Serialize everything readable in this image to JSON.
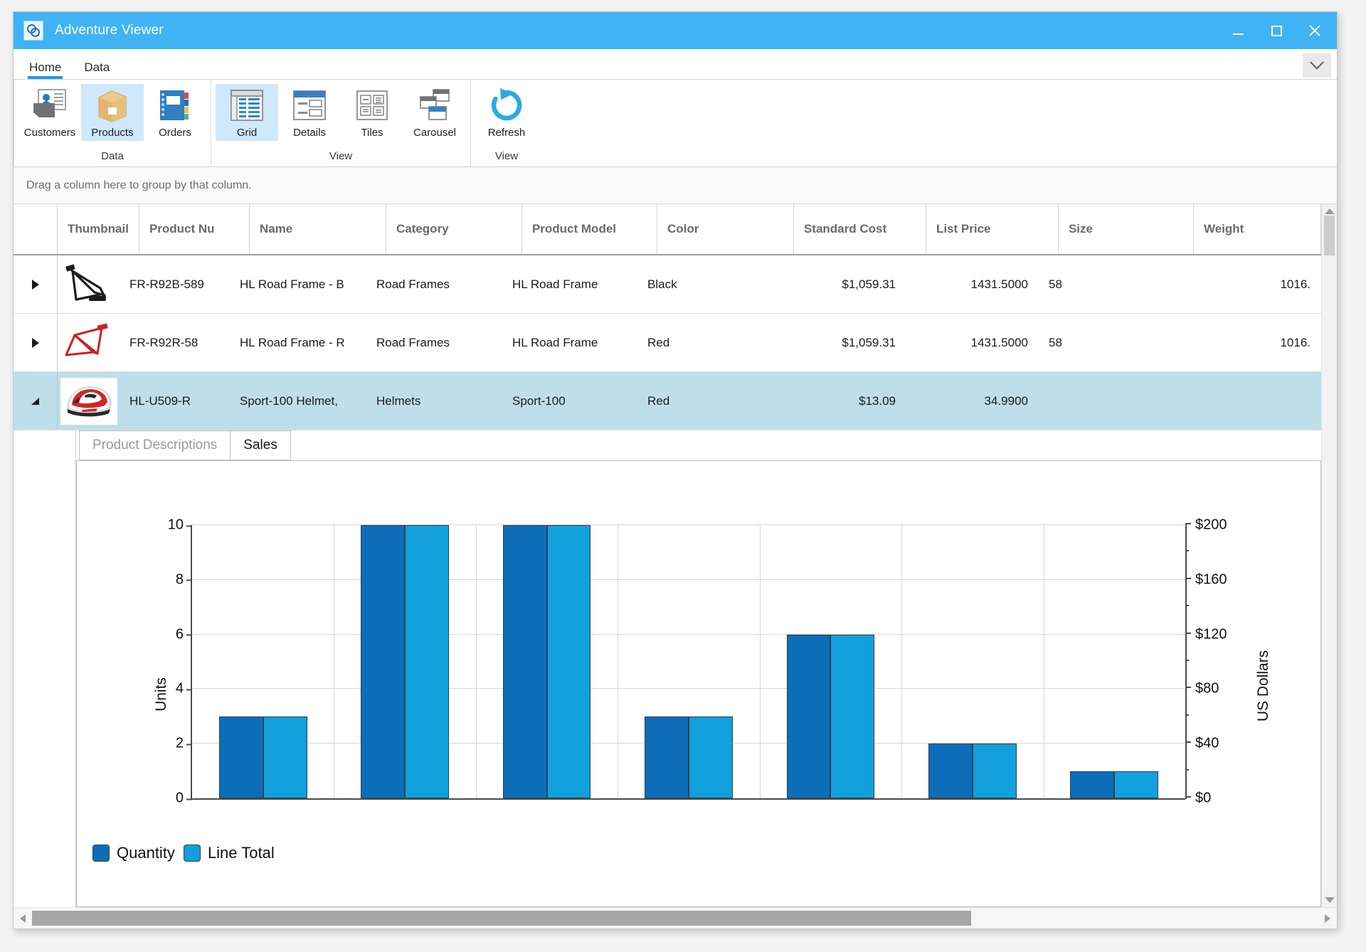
{
  "window": {
    "title": "Adventure Viewer",
    "icon": "app-icon",
    "minimize_label": "Minimize",
    "maximize_label": "Maximize",
    "close_label": "Close"
  },
  "ribbon": {
    "tabs": [
      {
        "label": "Home",
        "active": true
      },
      {
        "label": "Data",
        "active": false
      }
    ],
    "collapse_label": "Collapse the Ribbon",
    "groups": [
      {
        "label": "Data",
        "items": [
          {
            "label": "Customers",
            "icon": "customers-icon",
            "selected": false
          },
          {
            "label": "Products",
            "icon": "products-icon",
            "selected": true
          },
          {
            "label": "Orders",
            "icon": "orders-icon",
            "selected": false
          }
        ]
      },
      {
        "label": "View",
        "items": [
          {
            "label": "Grid",
            "icon": "grid-icon",
            "selected": true
          },
          {
            "label": "Details",
            "icon": "details-icon",
            "selected": false
          },
          {
            "label": "Tiles",
            "icon": "tiles-icon",
            "selected": false
          },
          {
            "label": "Carousel",
            "icon": "carousel-icon",
            "selected": false
          }
        ]
      },
      {
        "label": "View",
        "items": [
          {
            "label": "Refresh",
            "icon": "refresh-icon",
            "selected": false
          }
        ]
      }
    ]
  },
  "group_panel": {
    "hint": "Drag a column here to group by that column."
  },
  "grid": {
    "columns": [
      {
        "key": "thumbnail",
        "label": "Thumbnail"
      },
      {
        "key": "product_number",
        "label": "Product Nu"
      },
      {
        "key": "name",
        "label": "Name"
      },
      {
        "key": "category",
        "label": "Category"
      },
      {
        "key": "product_model",
        "label": "Product Model"
      },
      {
        "key": "color",
        "label": "Color"
      },
      {
        "key": "standard_cost",
        "label": "Standard Cost"
      },
      {
        "key": "list_price",
        "label": "List Price"
      },
      {
        "key": "size",
        "label": "Size"
      },
      {
        "key": "weight",
        "label": "Weight"
      }
    ],
    "rows": [
      {
        "expander": "collapsed",
        "thumbnail": "black-road-frame-thumbnail",
        "product_number": "FR-R92B-589",
        "name": "HL Road Frame - B",
        "category": "Road Frames",
        "product_model": "HL Road Frame",
        "color": "Black",
        "standard_cost": "$1,059.31",
        "list_price": "1431.5000",
        "size": "58",
        "weight": "1016.",
        "selected": false
      },
      {
        "expander": "collapsed",
        "thumbnail": "red-road-frame-thumbnail",
        "product_number": "FR-R92R-58",
        "name": "HL Road Frame - R",
        "category": "Road Frames",
        "product_model": "HL Road Frame",
        "color": "Red",
        "standard_cost": "$1,059.31",
        "list_price": "1431.5000",
        "size": "58",
        "weight": "1016.",
        "selected": false
      },
      {
        "expander": "expanded",
        "thumbnail": "red-helmet-thumbnail",
        "product_number": "HL-U509-R",
        "name": "Sport-100 Helmet,",
        "category": "Helmets",
        "product_model": "Sport-100",
        "color": "Red",
        "standard_cost": "$13.09",
        "list_price": "34.9900",
        "size": "",
        "weight": "",
        "selected": true
      }
    ]
  },
  "detail": {
    "tabs": [
      {
        "label": "Product Descriptions",
        "active": false
      },
      {
        "label": "Sales",
        "active": true
      }
    ]
  },
  "chart_data": {
    "type": "bar",
    "title": "",
    "xlabel": "",
    "ylabel": "Units",
    "y2label": "US Dollars",
    "ylim": [
      0,
      10
    ],
    "y2lim": [
      0,
      200
    ],
    "yticks": [
      0,
      2,
      4,
      6,
      8,
      10
    ],
    "y2ticks": [
      "$0",
      "$40",
      "$80",
      "$120",
      "$160",
      "$200"
    ],
    "y2tick_values": [
      0,
      40,
      80,
      120,
      160,
      200
    ],
    "grid": true,
    "legend_position": "bottom-left",
    "categories": [
      "1",
      "2",
      "3",
      "4",
      "5",
      "6",
      "7"
    ],
    "xtick_labels": [
      "",
      "",
      "",
      "",
      "",
      "",
      ""
    ],
    "series": [
      {
        "name": "Quantity",
        "color": "#0c6eb8",
        "values": [
          3,
          10,
          10,
          3,
          6,
          2,
          1
        ]
      },
      {
        "name": "Line Total",
        "color": "#12a0dd",
        "values": [
          3,
          10,
          10,
          3,
          6,
          2,
          1
        ]
      }
    ]
  },
  "scrollbars": {
    "vertical_up": "scroll-up",
    "vertical_down": "scroll-down",
    "horizontal_left": "scroll-left",
    "horizontal_right": "scroll-right"
  },
  "colors": {
    "titlebar": "#3fb3f4",
    "accent": "#2196f3",
    "selection_row": "#bedfe9",
    "ribbon_selected": "#cfe8fb",
    "series_quantity": "#0c6eb8",
    "series_line_total": "#12a0dd"
  }
}
